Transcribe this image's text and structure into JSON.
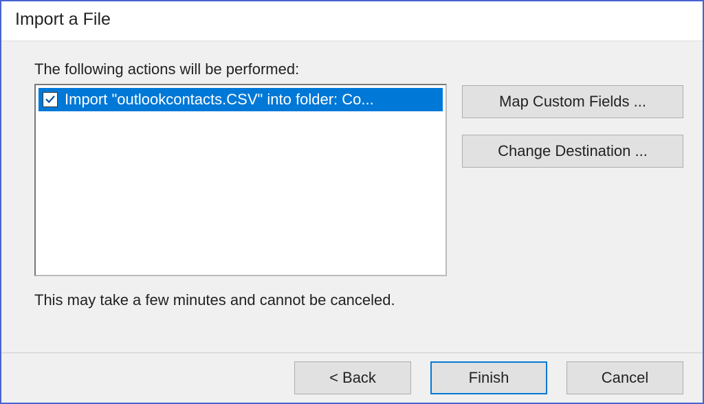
{
  "dialog": {
    "title": "Import a File"
  },
  "main": {
    "actions_label": "The following actions will be performed:",
    "items": [
      {
        "checked": true,
        "text": "Import \"outlookcontacts.CSV\" into folder: Co..."
      }
    ],
    "note": "This may take a few minutes and cannot be canceled."
  },
  "side": {
    "map_fields": "Map Custom Fields ...",
    "change_dest": "Change Destination ..."
  },
  "footer": {
    "back": "< Back",
    "finish": "Finish",
    "cancel": "Cancel"
  }
}
